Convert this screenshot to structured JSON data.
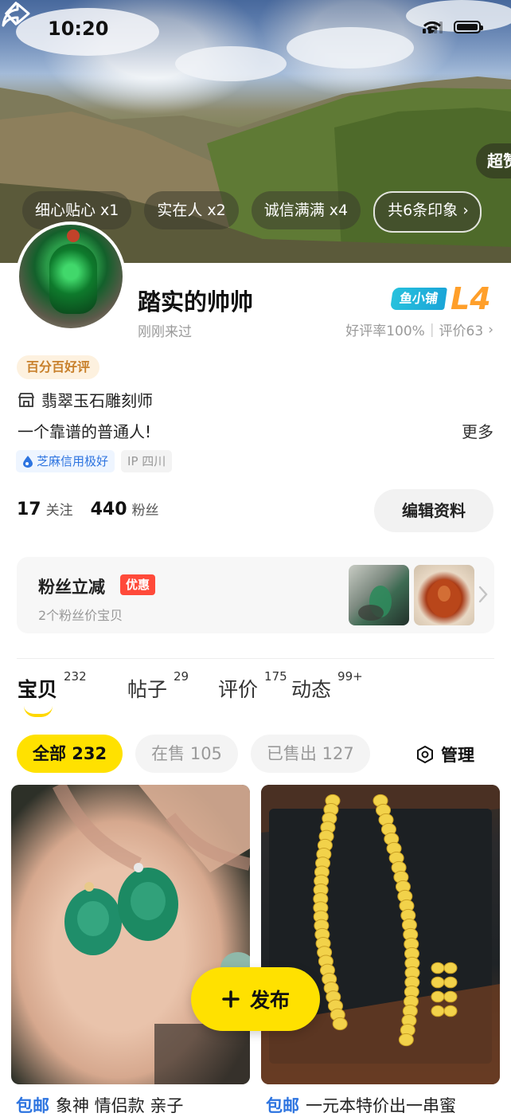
{
  "status_bar": {
    "time": "10:20"
  },
  "banner": {
    "super_chip": "超赞",
    "tags": [
      {
        "label": "细心贴心",
        "count": "x1"
      },
      {
        "label": "实在人",
        "count": "x2"
      },
      {
        "label": "诚信满满",
        "count": "x4"
      }
    ],
    "impressions": "共6条印象"
  },
  "profile": {
    "username": "踏实的帅帅",
    "last_seen": "刚刚来过",
    "shop_badge": "鱼小铺",
    "shop_level": "L4",
    "good_rate": "好评率100%",
    "review_count": "评价63",
    "good_badge": "百分百好评",
    "job": "翡翠玉石雕刻师",
    "bio": "一个靠谱的普通人!",
    "more": "更多",
    "credit": "芝麻信用极好",
    "ip": "IP 四川"
  },
  "stats": {
    "following": "17",
    "following_label": "关注",
    "fans": "440",
    "fans_label": "粉丝",
    "edit_button": "编辑资料"
  },
  "fan_card": {
    "title": "粉丝立减",
    "tag": "优惠",
    "subtitle": "2个粉丝价宝贝"
  },
  "tabs": [
    {
      "label": "宝贝",
      "count": "232"
    },
    {
      "label": "帖子",
      "count": "29"
    },
    {
      "label": "评价",
      "count": "175"
    },
    {
      "label": "动态",
      "count": "99+"
    }
  ],
  "filters": [
    {
      "label": "全部 232"
    },
    {
      "label": "在售 105"
    },
    {
      "label": "已售出 127"
    }
  ],
  "manage_label": "管理",
  "products": [
    {
      "free_shipping": "包邮",
      "title": "象神 情侣款 亲子"
    },
    {
      "free_shipping": "包邮",
      "title": "一元本特价出一串蜜"
    }
  ],
  "publish_label": "发布",
  "colors": {
    "accent_yellow": "#ffe100",
    "level_orange": "#ff9f2a",
    "link_blue": "#2d74e0"
  }
}
